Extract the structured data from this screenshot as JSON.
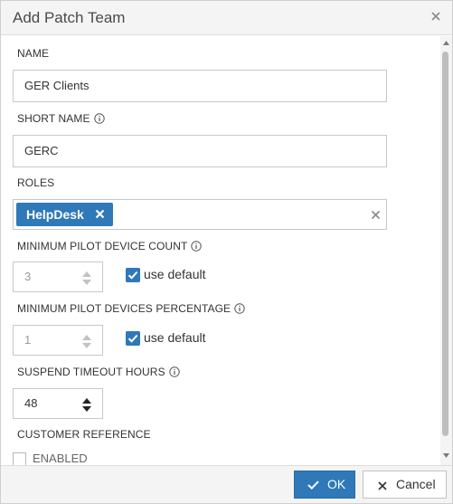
{
  "dialog": {
    "title": "Add Patch Team",
    "close_icon": "close-icon"
  },
  "fields": {
    "name": {
      "label": "NAME",
      "value": "GER Clients"
    },
    "short_name": {
      "label": "SHORT NAME",
      "value": "GERC",
      "icon": "info-icon"
    },
    "roles": {
      "label": "ROLES",
      "chips": [
        "HelpDesk"
      ],
      "chip_remove_icon": "remove-icon",
      "clear_icon": "clear-icon"
    },
    "min_pilot_count": {
      "label": "MINIMUM PILOT DEVICE COUNT",
      "value": "3",
      "use_default_label": "use default",
      "use_default_checked": true,
      "disabled": true
    },
    "min_pilot_percentage": {
      "label": "MINIMUM PILOT DEVICES PERCENTAGE",
      "value": "1",
      "use_default_label": "use default",
      "use_default_checked": true,
      "disabled": true
    },
    "suspend_timeout": {
      "label": "SUSPEND TIMEOUT HOURS",
      "value": "48"
    },
    "customer_reference": {
      "label": "CUSTOMER REFERENCE",
      "enabled_label": "ENABLED",
      "enabled_checked": false
    }
  },
  "footer": {
    "ok_label": "OK",
    "cancel_label": "Cancel"
  },
  "colors": {
    "accent": "#2f79b9",
    "title_bar": "#f4f4f4",
    "border": "#c8c8c8"
  }
}
